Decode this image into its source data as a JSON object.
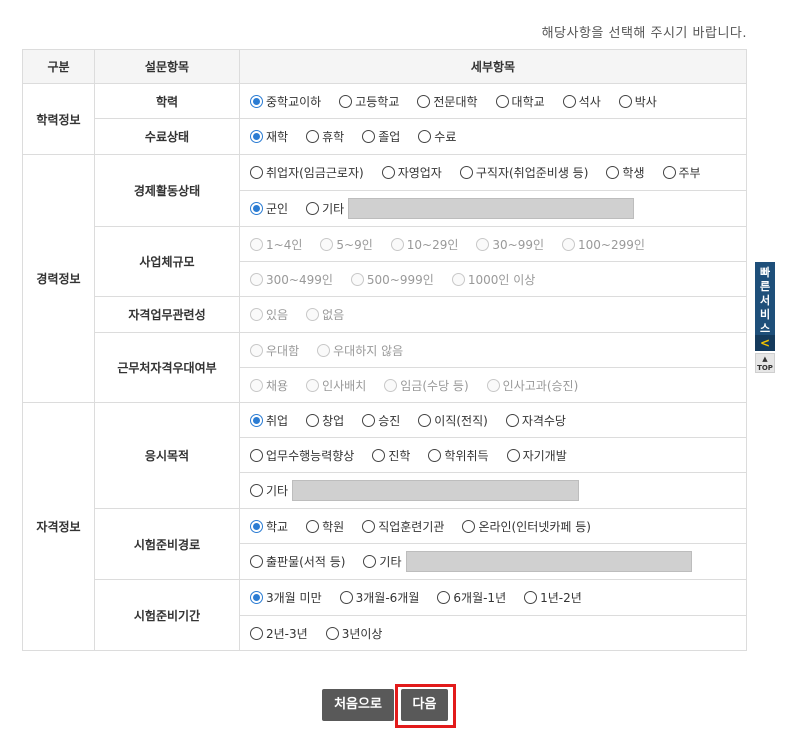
{
  "notice": "해당사항을 선택해 주시기 바랍니다.",
  "headers": {
    "category": "구분",
    "item": "설문항목",
    "detail": "세부항목"
  },
  "categories": {
    "education": "학력정보",
    "career": "경력정보",
    "qualification": "자격정보"
  },
  "items": {
    "education": "학력",
    "enrollment": "수료상태",
    "economic_activity": "경제활동상태",
    "company_size": "사업체규모",
    "job_relevance": "자격업무관련성",
    "workplace_preference": "근무처자격우대여부",
    "exam_purpose": "응시목적",
    "prep_path": "시험준비경로",
    "prep_period": "시험준비기간"
  },
  "options": {
    "education": [
      "중학교이하",
      "고등학교",
      "전문대학",
      "대학교",
      "석사",
      "박사"
    ],
    "enrollment": [
      "재학",
      "휴학",
      "졸업",
      "수료"
    ],
    "economic_activity_1": [
      "취업자(임금근로자)",
      "자영업자",
      "구직자(취업준비생 등)",
      "학생",
      "주부"
    ],
    "economic_activity_2": [
      "군인",
      "기타"
    ],
    "company_size_1": [
      "1~4인",
      "5~9인",
      "10~29인",
      "30~99인",
      "100~299인"
    ],
    "company_size_2": [
      "300~499인",
      "500~999인",
      "1000인 이상"
    ],
    "job_relevance": [
      "있음",
      "없음"
    ],
    "workplace_preference_1": [
      "우대함",
      "우대하지 않음"
    ],
    "workplace_preference_2": [
      "채용",
      "인사배치",
      "임금(수당 등)",
      "인사고과(승진)"
    ],
    "exam_purpose_1": [
      "취업",
      "창업",
      "승진",
      "이직(전직)",
      "자격수당"
    ],
    "exam_purpose_2": [
      "업무수행능력향상",
      "진학",
      "학위취득",
      "자기개발"
    ],
    "exam_purpose_3": [
      "기타"
    ],
    "prep_path_1": [
      "학교",
      "학원",
      "직업훈련기관",
      "온라인(인터넷카페 등)"
    ],
    "prep_path_2": [
      "출판물(서적 등)",
      "기타"
    ],
    "prep_period_1": [
      "3개월 미만",
      "3개월-6개월",
      "6개월-1년",
      "1년-2년"
    ],
    "prep_period_2": [
      "2년-3년",
      "3년이상"
    ]
  },
  "selected": {
    "education": "중학교이하",
    "enrollment": "재학",
    "economic_activity": "군인",
    "exam_purpose": "취업",
    "prep_path": "학교",
    "prep_period": "3개월 미만"
  },
  "buttons": {
    "first": "처음으로",
    "next": "다음"
  },
  "quick_service": {
    "label_chars": [
      "빠",
      "른",
      "서",
      "비",
      "스"
    ],
    "arrow": "<",
    "top_arrow": "▲",
    "top_label": "TOP"
  }
}
